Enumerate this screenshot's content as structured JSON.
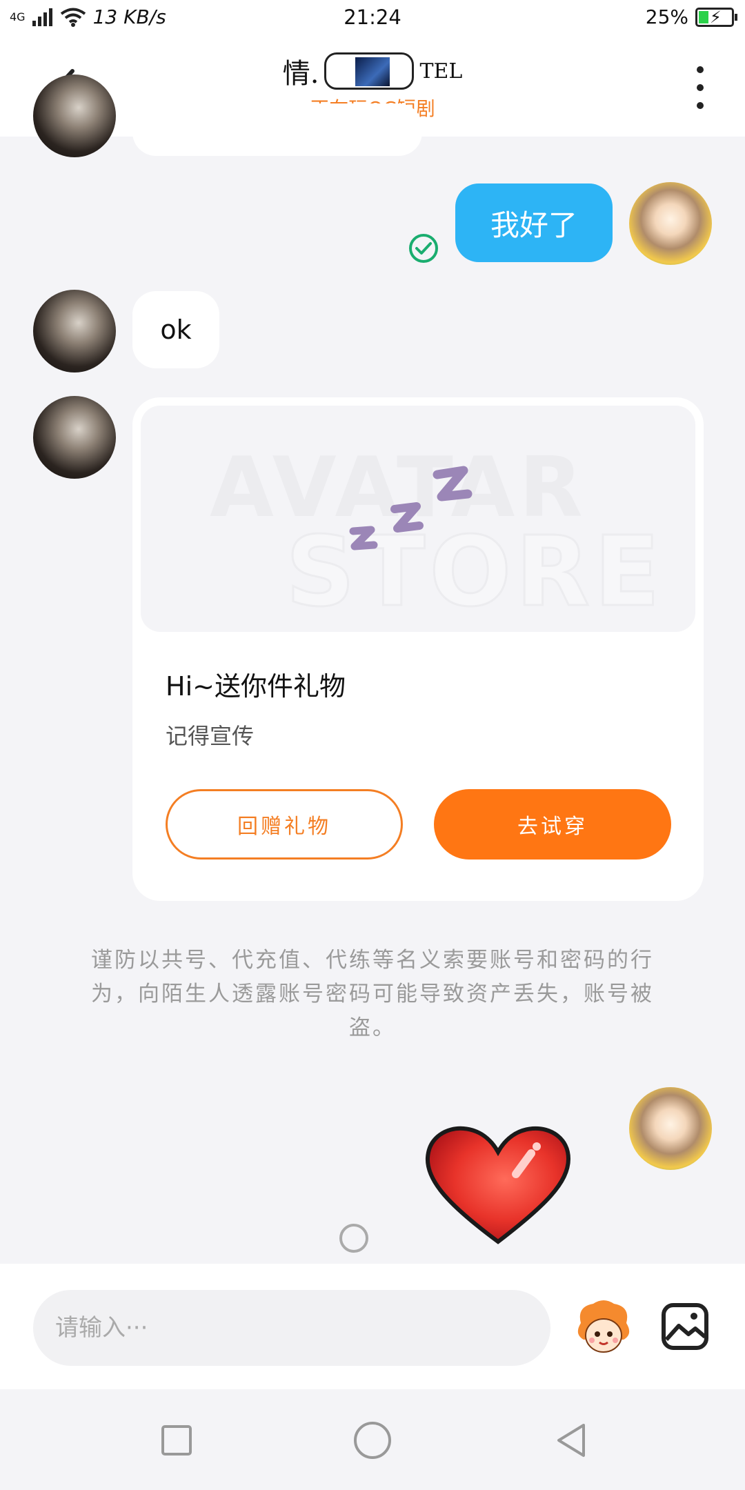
{
  "status_bar": {
    "network": "4G",
    "speed": "13 KB/s",
    "time": "21:24",
    "battery": "25%"
  },
  "header": {
    "title_left": "情.",
    "title_right": "TEL",
    "subtitle": "正在玩OC短剧"
  },
  "messages": {
    "sent_text": "我好了",
    "received_text": "ok"
  },
  "gift_card": {
    "watermark_top": "AVATAR",
    "watermark_bottom": "STORE",
    "title": "Hi~送你件礼物",
    "subtitle": "记得宣传",
    "return_gift_label": "回赠礼物",
    "try_on_label": "去试穿"
  },
  "warning": "谨防以共号、代充值、代练等名义索要账号和密码的行为，向陌生人透露账号密码可能导致资产丢失，账号被盗。",
  "input": {
    "placeholder": "请输入···"
  },
  "colors": {
    "accent": "#ff7613",
    "bubble_blue": "#2db4f5",
    "read_check": "#1aad6f"
  }
}
